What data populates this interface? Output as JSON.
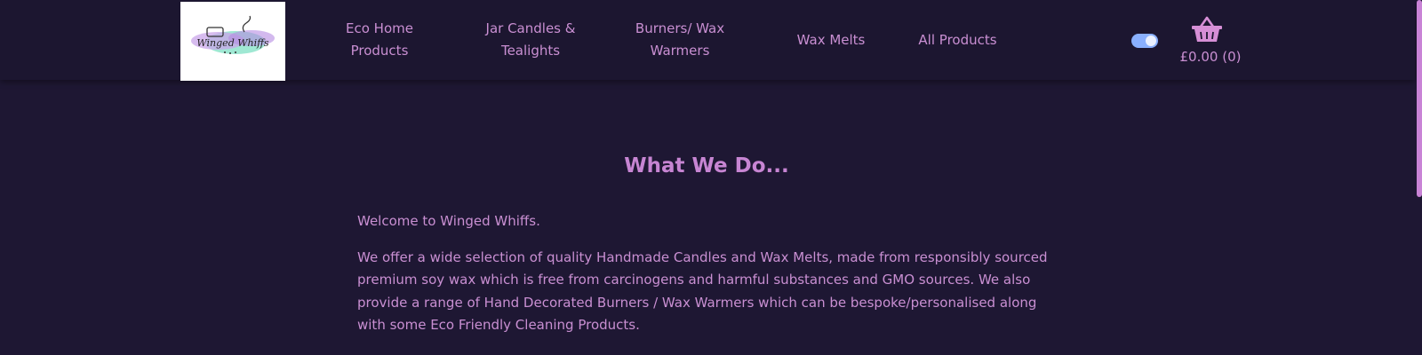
{
  "header": {
    "logo": {
      "text": "Winged Whiffs",
      "alt": "Winged Whiffs logo"
    },
    "nav": [
      {
        "label": "Eco Home Products"
      },
      {
        "label": "Jar Candles & Tealights"
      },
      {
        "label": "Burners/ Wax Warmers"
      },
      {
        "label": "Wax Melts"
      },
      {
        "label": "All Products"
      }
    ],
    "theme_toggle": {
      "state": "on"
    },
    "cart": {
      "total": "£0.00 (0)",
      "icon": "basket-icon"
    }
  },
  "main": {
    "title": "What We Do...",
    "paragraphs": [
      "Welcome to Winged Whiffs.",
      "We offer a wide selection of quality Handmade Candles and Wax Melts, made from responsibly sourced premium soy wax which is free from carcinogens and harmful substances and GMO sources. We also provide a range of Hand Decorated Burners / Wax Warmers which can be bespoke/personalised along with some Eco Friendly Cleaning Products."
    ]
  },
  "colors": {
    "background": "#1e1733",
    "header": "#1c1630",
    "accent": "#d68fd6",
    "toggle": "#8ab0ff"
  }
}
